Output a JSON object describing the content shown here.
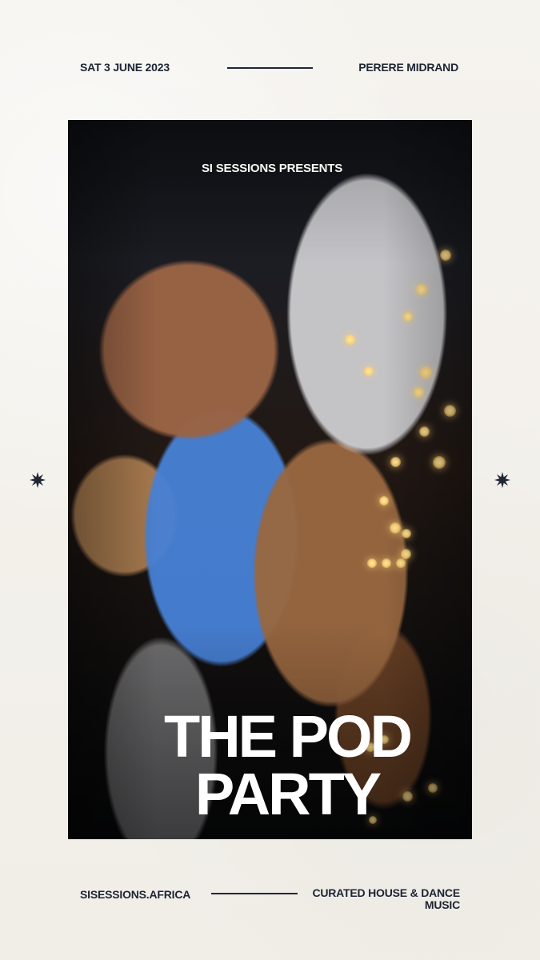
{
  "header": {
    "date": "SAT 3 JUNE 2023",
    "venue": "PERERE   MIDRAND"
  },
  "poster": {
    "presents": "SI SESSIONS PRESENTS",
    "title": "THE POD\nPARTY"
  },
  "footer": {
    "website": "SISESSIONS.AFRICA",
    "genre": "CURATED HOUSE & DANCE MUSIC"
  },
  "icons": {
    "left": "star-icon",
    "right": "star-icon"
  }
}
